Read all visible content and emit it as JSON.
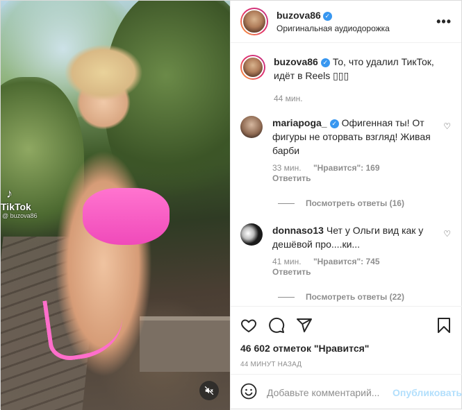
{
  "media": {
    "watermark_brand": "TikTok",
    "watermark_user": "@ buzova86"
  },
  "header": {
    "username": "buzova86",
    "subtitle": "Оригинальная аудиодорожка",
    "more_icon": "ellipsis-icon"
  },
  "caption": {
    "username": "buzova86",
    "text": "То, что удалил ТикТок, идёт в Reels ",
    "time": "44 мин."
  },
  "comments": [
    {
      "username": "mariapoga_",
      "verified": true,
      "text": "Офигенная ты! От фигуры не оторвать взгляд! Живая барби",
      "time": "33 мин.",
      "likes": "\"Нравится\": 169",
      "reply": "Ответить",
      "view_replies": "Посмотреть ответы (16)"
    },
    {
      "username": "donnaso13",
      "verified": false,
      "text": "Чет у Ольги вид как у дешёвой про....ки...",
      "time": "41 мин.",
      "likes": "\"Нравится\": 745",
      "reply": "Ответить",
      "view_replies": "Посмотреть ответы (22)"
    }
  ],
  "actions": {
    "like_icon": "heart-icon",
    "comment_icon": "comment-icon",
    "share_icon": "paper-plane-icon",
    "save_icon": "bookmark-icon",
    "likes_count": "46 602 отметок \"Нравится\"",
    "posted_time": "44 минут назад"
  },
  "add_comment": {
    "placeholder": "Добавьте комментарий...",
    "post_label": "Опубликовать"
  }
}
